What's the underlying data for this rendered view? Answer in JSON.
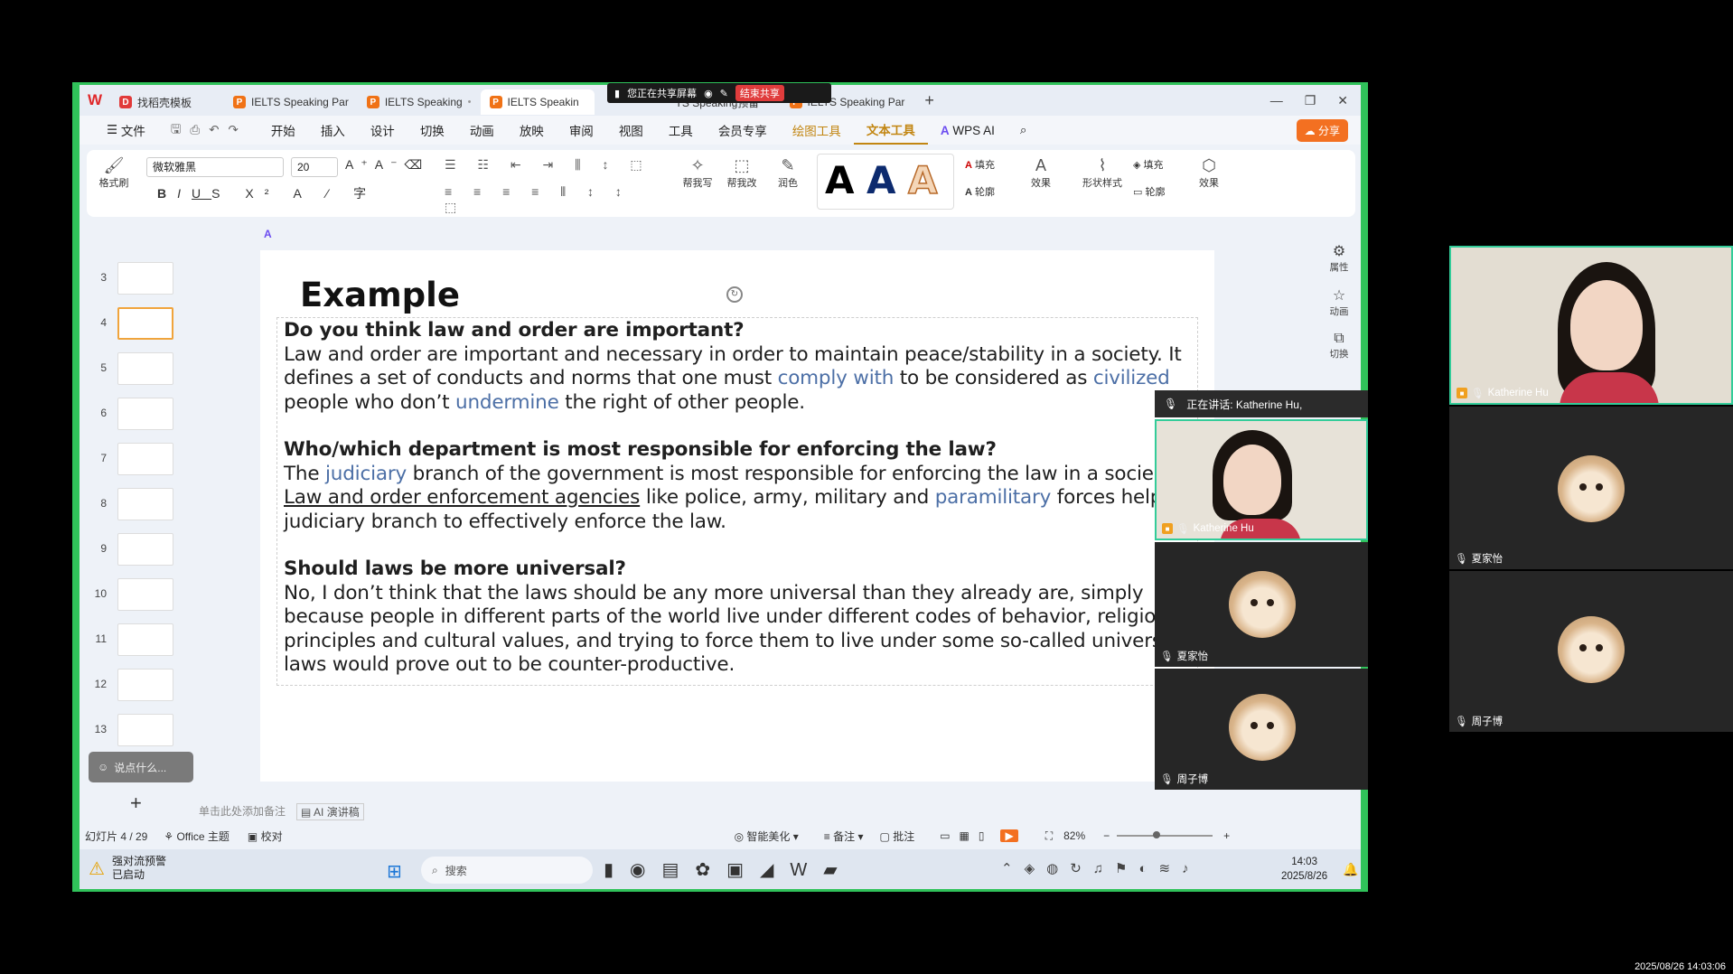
{
  "tabs": [
    {
      "label": "找稻壳模板",
      "icon": "docer-icon",
      "active": false
    },
    {
      "label": "IELTS Speaking Par",
      "active": false
    },
    {
      "label": "IELTS Speaking",
      "active": false
    },
    {
      "label": "IELTS Speakin",
      "active": true
    },
    {
      "label": "TS Speaking预备",
      "active": false
    },
    {
      "label": "IELTS Speaking Par",
      "active": false
    }
  ],
  "sharebar": {
    "status": "您正在共享屏幕",
    "end": "结束共享"
  },
  "menu": {
    "file": "文件",
    "items": [
      "开始",
      "插入",
      "设计",
      "切换",
      "动画",
      "放映",
      "审阅",
      "视图",
      "工具",
      "会员专享"
    ],
    "draw_tools": "绘图工具",
    "text_tools": "文本工具",
    "wps_ai": "WPS AI",
    "share": "分享"
  },
  "ribbon": {
    "format_painter": "格式刷",
    "font_name": "微软雅黑",
    "font_size": "20",
    "help_write": "帮我写",
    "help_edit": "帮我改",
    "polish": "润色",
    "fill": "填充",
    "outline": "轮廓",
    "effect": "效果",
    "shape_style": "形状样式",
    "fill2": "填充",
    "outline2": "轮廓",
    "effect2": "效果"
  },
  "thumbnails": [
    {
      "num": "3"
    },
    {
      "num": "4",
      "selected": true
    },
    {
      "num": "5"
    },
    {
      "num": "6"
    },
    {
      "num": "7"
    },
    {
      "num": "8"
    },
    {
      "num": "9"
    },
    {
      "num": "10"
    },
    {
      "num": "11"
    },
    {
      "num": "12"
    },
    {
      "num": "13"
    }
  ],
  "comment_box": "说点什么...",
  "slide": {
    "title": "Example",
    "q1": "Do you think law and order are important?",
    "a1_1": " Law and order are important and necessary in order to maintain peace/stability in a society. It defines a set of conducts and norms that one must ",
    "a1_h1": "comply with",
    "a1_2": " to be considered as ",
    "a1_h2": "civilized",
    "a1_3": " people who don’t ",
    "a1_h3": "undermine",
    "a1_4": " the right of other people.",
    "q2": "Who/which department is most responsible for enforcing the law?",
    "a2_1": " The ",
    "a2_h1": "judiciary",
    "a2_2": " branch of the government is most responsible for enforcing the law in a socie",
    "a2_u": "Law and order enforcement agencies",
    "a2_3": " like police, army, military and ",
    "a2_h2": "paramilitary",
    "a2_4": " forces help judiciary branch to effectively enforce the law.",
    "q3": " Should laws be more universal?",
    "a3": " No, I don’t think that the laws should be any more universal than they already are, simply because people in different parts of the world live under different codes of behavior, religio principles and cultural values, and trying to force them to live under some so-called univers laws would prove out to be counter-productive."
  },
  "rightbar": {
    "props": "属性",
    "anim": "动画",
    "switch": "切换"
  },
  "notes_placeholder": "单击此处添加备注",
  "ai_notes": "AI 演讲稿",
  "status": {
    "slide": "幻灯片 4 / 29",
    "theme": "Office 主题",
    "proof": "校对",
    "beautify": "智能美化",
    "notes": "备注",
    "comment": "批注",
    "zoom": "82%"
  },
  "taskbar": {
    "warning_title": "强对流预警",
    "warning_sub": "已启动",
    "search": "搜索",
    "time": "14:03",
    "date": "2025/8/26"
  },
  "meeting": {
    "speaking": "正在讲话:  Katherine Hu,",
    "participants": [
      {
        "name": "Katherine Hu"
      },
      {
        "name": "夏家怡"
      },
      {
        "name": "周子博"
      }
    ]
  },
  "gallery": [
    {
      "name": "Katherine Hu"
    },
    {
      "name": "夏家怡"
    },
    {
      "name": "周子博"
    }
  ],
  "timestamp": "2025/08/26 14:03:06"
}
